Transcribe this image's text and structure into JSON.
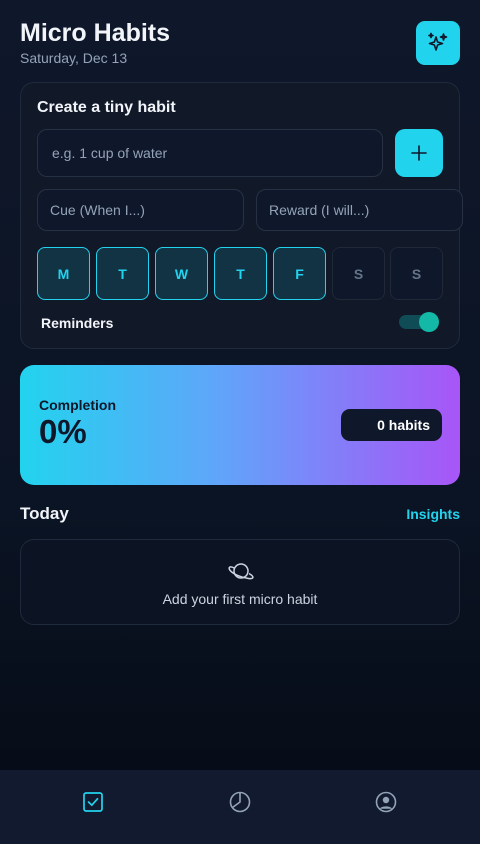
{
  "header": {
    "title": "Micro Habits",
    "date": "Saturday, Dec 13",
    "action_icon": "sparkles-icon"
  },
  "create_habit": {
    "title": "Create a tiny habit",
    "habit_placeholder": "e.g. 1 cup of water",
    "habit_value": "",
    "add_icon": "plus-icon",
    "cue_placeholder": "Cue (When I...)",
    "cue_value": "",
    "reward_placeholder": "Reward (I will...)",
    "reward_value": "",
    "days": [
      {
        "label": "M",
        "selected": true
      },
      {
        "label": "T",
        "selected": true
      },
      {
        "label": "W",
        "selected": true
      },
      {
        "label": "T",
        "selected": true
      },
      {
        "label": "F",
        "selected": true
      },
      {
        "label": "S",
        "selected": false
      },
      {
        "label": "S",
        "selected": false
      }
    ],
    "reminders_label": "Reminders",
    "reminders_enabled": true
  },
  "completion": {
    "label": "Completion",
    "value": "0%",
    "habits_badge": "0 habits"
  },
  "today": {
    "title": "Today",
    "insights_label": "Insights",
    "empty_icon": "planet-icon",
    "empty_text": "Add your first micro habit"
  },
  "bottom_nav": {
    "items": [
      {
        "icon": "checkbox-icon",
        "active": true
      },
      {
        "icon": "pie-chart-icon",
        "active": false
      },
      {
        "icon": "user-circle-icon",
        "active": false
      }
    ]
  },
  "colors": {
    "accent": "#22d3ee",
    "gradient_start": "#22d3ee",
    "gradient_end": "#a855f7",
    "background": "#0f172a"
  }
}
